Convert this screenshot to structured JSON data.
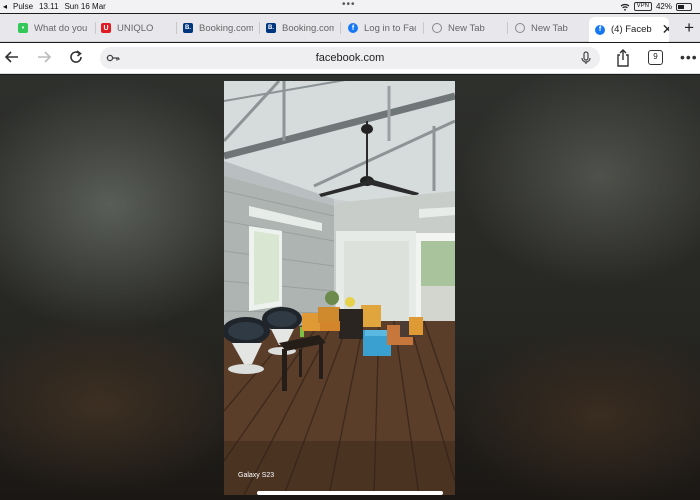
{
  "statusbar": {
    "carrier": "Pulse",
    "time": "13.11",
    "date": "Sun 16 Mar",
    "vpn": "VPN",
    "battery": "42%",
    "dots": "•••"
  },
  "tabs": [
    {
      "label": "What do you",
      "favicon": "tripadvisor-icon",
      "fav_color": "#34c759",
      "fav_text": "•"
    },
    {
      "label": "UNIQLO",
      "favicon": "uniqlo-icon",
      "fav_color": "#e01b22",
      "fav_text": "U"
    },
    {
      "label": "Booking.com",
      "favicon": "booking-icon",
      "fav_color": "#003580",
      "fav_text": "B."
    },
    {
      "label": "Booking.com",
      "favicon": "booking-icon",
      "fav_color": "#003580",
      "fav_text": "B."
    },
    {
      "label": "Log in to Fac",
      "favicon": "facebook-icon",
      "fav_color": "#1877f2",
      "fav_text": "f"
    },
    {
      "label": "New Tab",
      "favicon": "globe-icon",
      "fav_color": "",
      "fav_text": ""
    },
    {
      "label": "New Tab",
      "favicon": "globe-icon",
      "fav_color": "",
      "fav_text": ""
    },
    {
      "label": "(4) Faceb",
      "favicon": "facebook-icon",
      "fav_color": "#1877f2",
      "fav_text": "f",
      "active": true
    }
  ],
  "toolbar": {
    "url": "facebook.com",
    "tab_count": "9"
  },
  "photo": {
    "label": "Galaxy S23"
  }
}
